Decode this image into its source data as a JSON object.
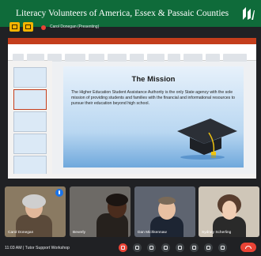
{
  "banner": {
    "title": "Literacy Volunteers of America, Essex & Passaic Counties",
    "logo_icon": "lva-logo-icon"
  },
  "meet_header": {
    "presenter_label": "Carol Donegan (Presenting)",
    "icons": [
      "present-icon",
      "chat-icon"
    ]
  },
  "slide": {
    "title": "The Mission",
    "body": "The Higher Education Student Assistance Authority is the only State agency with the sole mission of providing students and families with the financial and informational resources to pursue their education beyond high school.",
    "graphic": "graduation-cap-icon"
  },
  "participants": [
    {
      "name": "Carol Donegan",
      "mic_icon": "mic-active-icon"
    },
    {
      "name": "Beverly",
      "mic_icon": ""
    },
    {
      "name": "Dan Michkennaw",
      "mic_icon": ""
    },
    {
      "name": "Sydney Scherling",
      "mic_icon": ""
    }
  ],
  "bottom_bar": {
    "time_meeting": "11:03 AM | Tutor Support Workshop",
    "controls": [
      "mic-off-icon",
      "camera-icon",
      "captions-icon",
      "present-screen-icon",
      "raise-hand-icon",
      "more-options-icon",
      "end-call-icon"
    ]
  },
  "colors": {
    "banner": "#0f6b3a",
    "meet_bg": "#202124",
    "end_call": "#ea4335",
    "ppt_accent": "#c43e1c"
  }
}
